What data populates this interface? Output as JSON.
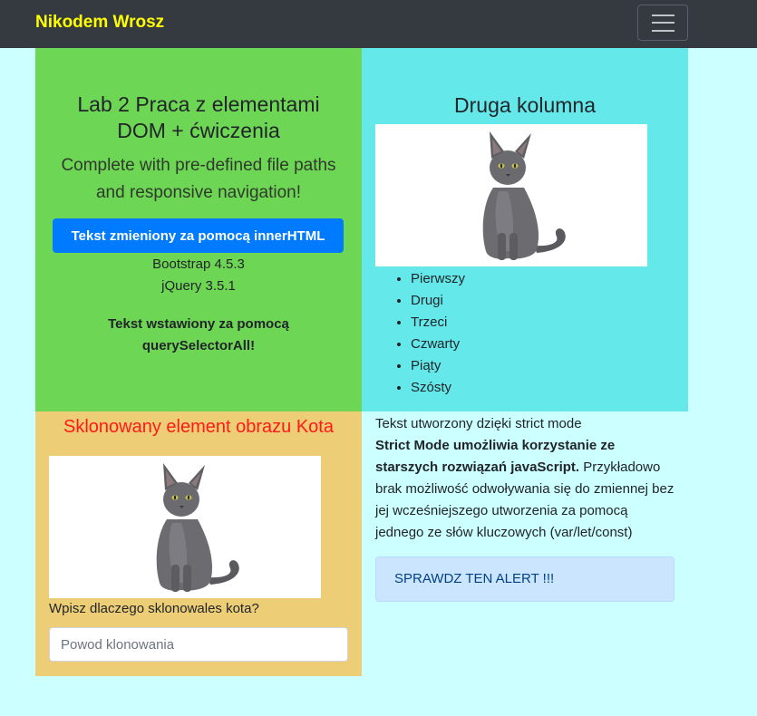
{
  "navbar": {
    "brand": "Nikodem Wrosz",
    "toggler_icon": "hamburger-icon"
  },
  "intro": {
    "title": "Lab 2 Praca z elementami DOM + ćwiczenia",
    "lead": "Complete with pre-defined file paths and responsive navigation!",
    "button_label": "Tekst zmieniony za pomocą innerHTML",
    "bootstrap_version": "Bootstrap 4.5.3",
    "jquery_version": "jQuery 3.5.1",
    "qs_text": "Tekst wstawiony za pomocą querySelectorAll!"
  },
  "column2": {
    "title": "Druga kolumna",
    "image_icon": "cat-image",
    "list": [
      "Pierwszy",
      "Drugi",
      "Trzeci",
      "Czwarty",
      "Piąty",
      "Szósty"
    ]
  },
  "clone": {
    "title": "Sklonowany element obrazu Kota",
    "image_icon": "cat-image",
    "label": "Wpisz dlaczego sklonowales kota?",
    "input_placeholder": "Powod klonowania",
    "input_value": ""
  },
  "strict": {
    "line1": "Tekst utworzony dzięki strict mode",
    "bold": "Strict Mode umożliwia korzystanie ze starszych rozwiązań javaScript.",
    "rest": " Przykładowo brak możliwość odwoływania się do zmiennej bez jej wcześniejszego utworzenia za pomocą jednego ze słów kluczowych (var/let/const)",
    "alert": "SPRAWDZ TEN ALERT !!!"
  },
  "colors": {
    "navbar": "#343a40",
    "brand": "#ffff00",
    "page_bg": "#ccffff",
    "green_panel": "#6ed655",
    "cyan_panel": "#64e8ea",
    "yellow_panel": "#edcd75",
    "primary_button": "#007bff",
    "clone_title": "#ff1a1a",
    "alert_bg": "#cce5ff",
    "alert_text": "#004085"
  }
}
